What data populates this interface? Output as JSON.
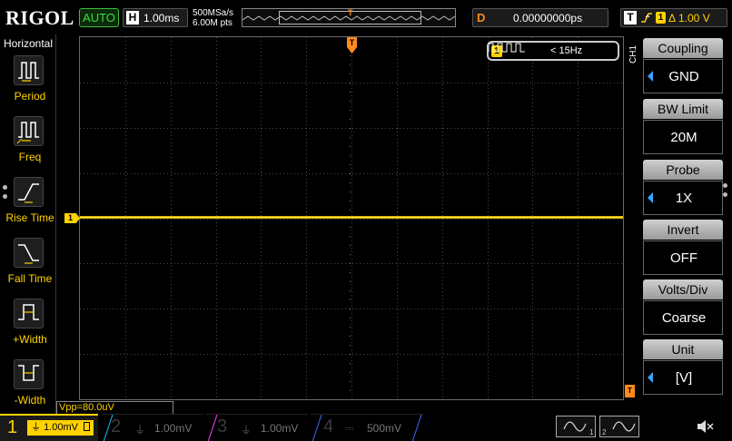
{
  "brand": "RIGOL",
  "run_mode": "AUTO",
  "timebase": {
    "badge": "H",
    "value": "1.00ms"
  },
  "sampling": {
    "rate": "500MSa/s",
    "depth": "6.00M pts"
  },
  "delay": {
    "badge": "D",
    "value": "0.00000000ps"
  },
  "trigger": {
    "badge": "T",
    "level": "1.00 V",
    "channel": "1"
  },
  "horizontal_menu": {
    "title": "Horizontal",
    "items": [
      {
        "label": "Period",
        "icon": "period-icon"
      },
      {
        "label": "Freq",
        "icon": "frequency-icon"
      },
      {
        "label": "Rise Time",
        "icon": "rise-time-icon"
      },
      {
        "label": "Fall Time",
        "icon": "fall-time-icon"
      },
      {
        "label": "+Width",
        "icon": "positive-width-icon"
      },
      {
        "label": "-Width",
        "icon": "negative-width-icon"
      }
    ]
  },
  "frequency_counter": {
    "channel": "1",
    "value": "< 15Hz"
  },
  "ch1_ground_marker": "1",
  "trigger_position_marker": "T",
  "measurement": "Vpp=80.0uV",
  "channel_menu": {
    "channel": "CH1",
    "items": [
      {
        "label": "Coupling",
        "value": "GND",
        "has_arrow": true
      },
      {
        "label": "BW Limit",
        "value": "20M",
        "has_arrow": false
      },
      {
        "label": "Probe",
        "value": "1X",
        "has_arrow": true
      },
      {
        "label": "Invert",
        "value": "OFF",
        "has_arrow": false
      },
      {
        "label": "Volts/Div",
        "value": "Coarse",
        "has_arrow": false
      },
      {
        "label": "Unit",
        "value": "[V]",
        "has_arrow": true
      }
    ]
  },
  "channels": [
    {
      "num": "1",
      "scale": "1.00mV",
      "color": "#ffd200",
      "active": true
    },
    {
      "num": "2",
      "scale": "1.00mV",
      "color": "#00c8ff",
      "active": false
    },
    {
      "num": "3",
      "scale": "1.00mV",
      "color": "#ff40ff",
      "active": false
    },
    {
      "num": "4",
      "scale": "500mV",
      "color": "#3a6bff",
      "active": false
    }
  ],
  "colors": {
    "ch1": "#ffd200",
    "trigger": "#ff8a1a",
    "menu_arrow": "#3aa3ff",
    "run_mode": "#3bdc3b"
  }
}
